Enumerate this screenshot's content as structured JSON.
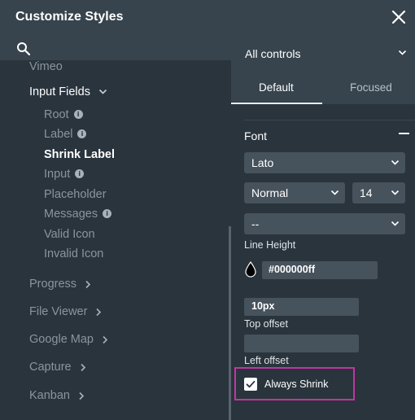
{
  "header": {
    "title": "Customize Styles"
  },
  "sidebar": {
    "items": [
      {
        "label": "Vimeo"
      },
      {
        "label": "Input Fields"
      },
      {
        "label": "Root"
      },
      {
        "label": "Label"
      },
      {
        "label": "Shrink Label"
      },
      {
        "label": "Input"
      },
      {
        "label": "Placeholder"
      },
      {
        "label": "Messages"
      },
      {
        "label": "Valid Icon"
      },
      {
        "label": "Invalid Icon"
      },
      {
        "label": "Progress"
      },
      {
        "label": "File Viewer"
      },
      {
        "label": "Google Map"
      },
      {
        "label": "Capture"
      },
      {
        "label": "Kanban"
      }
    ]
  },
  "controls_dropdown": {
    "value": "All controls"
  },
  "tabs": [
    {
      "label": "Default"
    },
    {
      "label": "Focused"
    }
  ],
  "font_section": {
    "title": "Font",
    "family": "Lato",
    "weight": "Normal",
    "size": "14",
    "line_height_value": "--",
    "line_height_label": "Line Height",
    "color": "#000000ff",
    "top_offset_value": "10px",
    "top_offset_label": "Top offset",
    "left_offset_value": "",
    "left_offset_label": "Left offset",
    "always_shrink_label": "Always Shrink",
    "always_shrink_checked": true
  },
  "colors": {
    "highlight": "#c2359f",
    "panel": "#29343d",
    "header": "#37434d"
  }
}
